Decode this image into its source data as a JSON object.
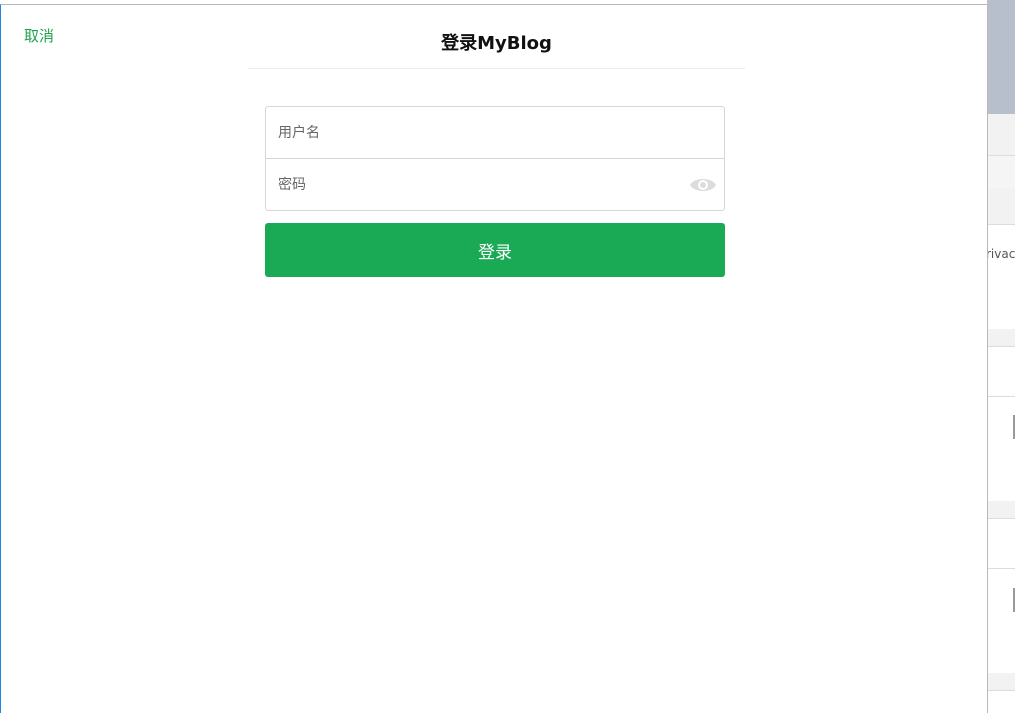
{
  "dialog": {
    "cancel_label": "取消",
    "title": "登录MyBlog"
  },
  "form": {
    "username": {
      "value": "",
      "placeholder": "用户名"
    },
    "password": {
      "value": "",
      "placeholder": "密码",
      "toggle_icon": "eye-icon"
    },
    "submit_label": "登录"
  },
  "background_window": {
    "partial_text": "rivac"
  },
  "colors": {
    "accent": "#1aaa55",
    "cancel_link": "#20a34e",
    "field_border": "#d6d6d6",
    "eye_icon": "#d9d9d9"
  }
}
